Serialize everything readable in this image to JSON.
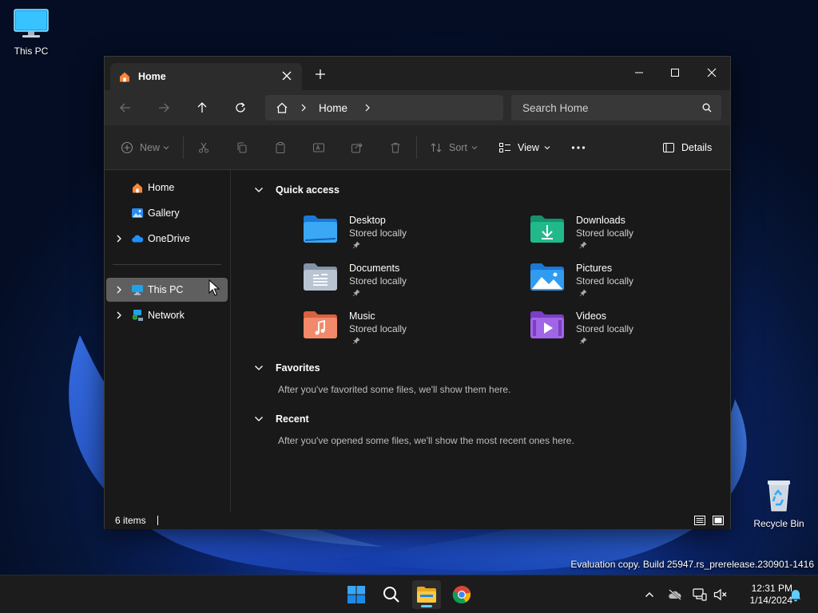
{
  "desktop": {
    "icons": [
      {
        "label": "This PC"
      },
      {
        "label": "Recycle Bin"
      }
    ],
    "watermark": "Evaluation copy. Build 25947.rs_prerelease.230901-1416"
  },
  "window": {
    "tab_title": "Home",
    "address": {
      "segments": [
        "Home"
      ]
    },
    "search_placeholder": "Search Home",
    "commands": {
      "new": "New",
      "sort": "Sort",
      "view": "View",
      "details": "Details"
    },
    "sidebar": {
      "items": [
        {
          "label": "Home"
        },
        {
          "label": "Gallery"
        },
        {
          "label": "OneDrive"
        },
        {
          "label": "This PC"
        },
        {
          "label": "Network"
        }
      ]
    },
    "quick_access": {
      "title": "Quick access",
      "folders": [
        {
          "name": "Desktop",
          "status": "Stored locally"
        },
        {
          "name": "Downloads",
          "status": "Stored locally"
        },
        {
          "name": "Documents",
          "status": "Stored locally"
        },
        {
          "name": "Pictures",
          "status": "Stored locally"
        },
        {
          "name": "Music",
          "status": "Stored locally"
        },
        {
          "name": "Videos",
          "status": "Stored locally"
        }
      ]
    },
    "favorites": {
      "title": "Favorites",
      "empty": "After you've favorited some files, we'll show them here."
    },
    "recent": {
      "title": "Recent",
      "empty": "After you've opened some files, we'll show the most recent ones here."
    },
    "status": {
      "items": "6 items"
    }
  },
  "taskbar": {
    "time": "12:31 PM",
    "date": "1/14/2024"
  },
  "colors": {
    "accent": "#60cdff",
    "selection": "#5f5f5f",
    "window_bg": "#191919"
  }
}
